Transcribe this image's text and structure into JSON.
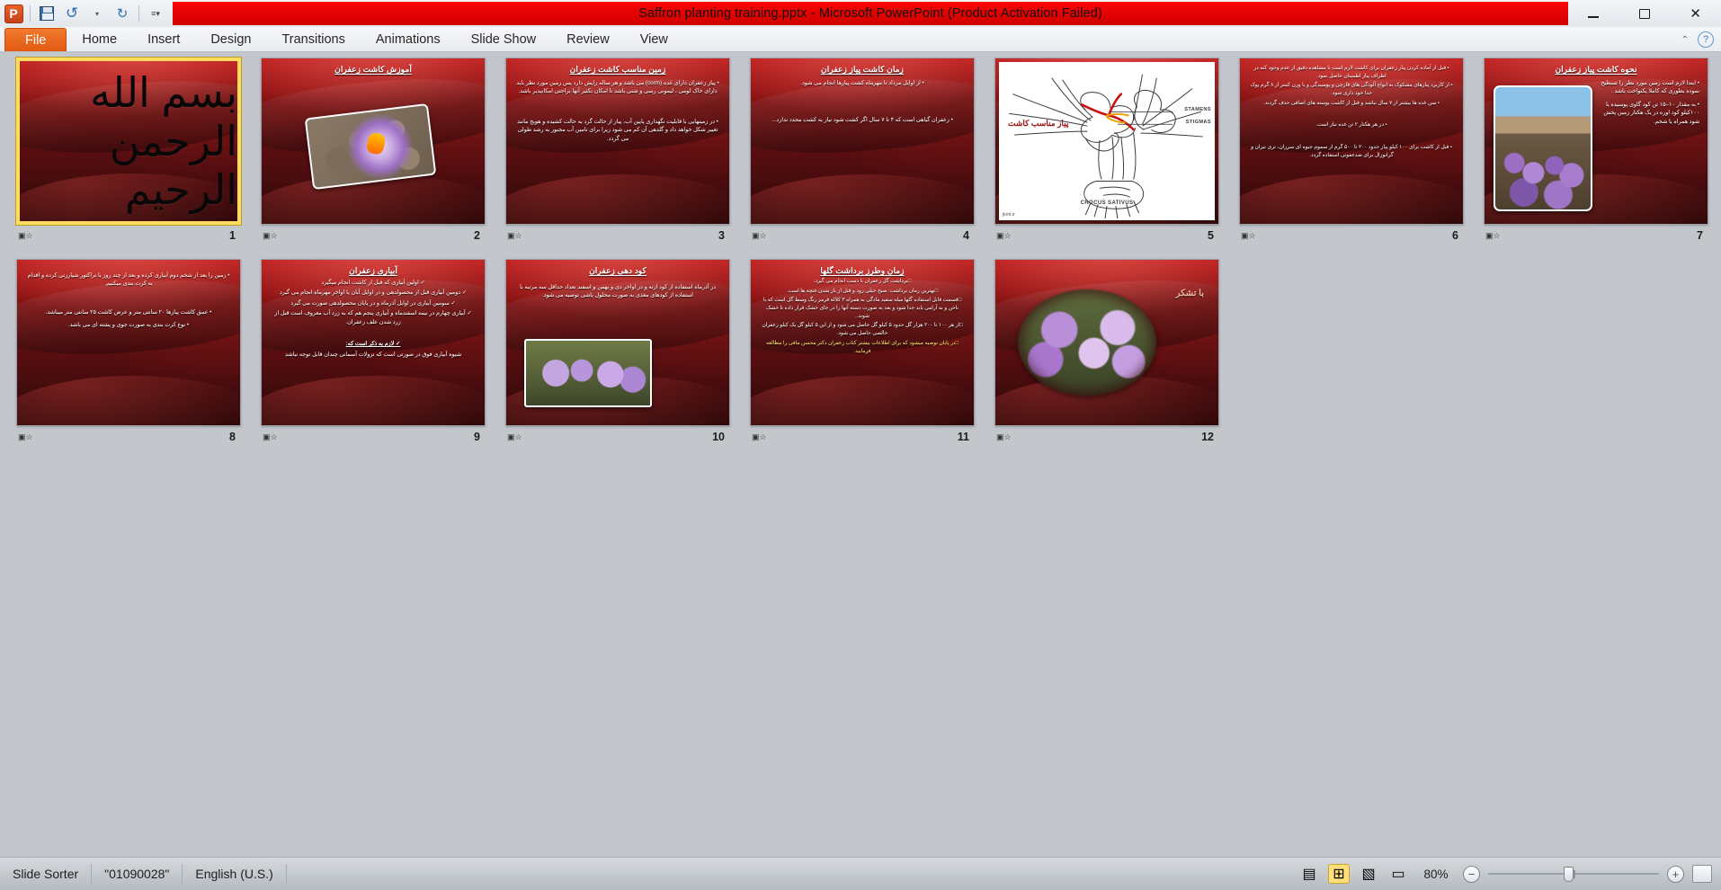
{
  "window": {
    "title": "Saffron planting training.pptx  -  Microsoft PowerPoint (Product Activation Failed)",
    "accent_red": "#e40202",
    "accent_orange": "#e35a10",
    "minimize": "–",
    "restore": "❐",
    "close": "✕"
  },
  "quick_access": {
    "app_icon": "powerpoint-icon",
    "app_letter": "P",
    "save": "save-icon",
    "undo": "↺",
    "undo_dropdown": "▾",
    "redo": "↻",
    "customize": "≡▾"
  },
  "ribbon": {
    "tabs": [
      {
        "label": "File",
        "active": true
      },
      {
        "label": "Home",
        "active": false
      },
      {
        "label": "Insert",
        "active": false
      },
      {
        "label": "Design",
        "active": false
      },
      {
        "label": "Transitions",
        "active": false
      },
      {
        "label": "Animations",
        "active": false
      },
      {
        "label": "Slide Show",
        "active": false
      },
      {
        "label": "Review",
        "active": false
      },
      {
        "label": "View",
        "active": false
      }
    ],
    "minimize_ribbon": "⌃",
    "help": "?"
  },
  "slides": [
    {
      "number": "1",
      "selected": true,
      "kind": "calligraphy",
      "title": "",
      "calligraphy": "بسم الله الرحمن الرحيم",
      "body": []
    },
    {
      "number": "2",
      "selected": false,
      "kind": "title-photo",
      "title": "آموزش کاشت زعفران",
      "body": []
    },
    {
      "number": "3",
      "selected": false,
      "kind": "text",
      "title": "زمین مناسب کاشت زعفران",
      "body": [
        "پیاز زعفران دارای غده (corm) می باشد و هر ساله زایش دارد پس زمین مورد نظر باید دارای خاک لومی ، لیمونی رسی و شنی باشد تا امکان تکثیر آنها براحتی امکانپذیر باشد.",
        "در زمینهایی با قابلیت نگهداری پایین آب، پیاز از حالت گرد به حالت کشیده و هویج مانند تغییر شکل خواهد داد و گلدهی آن کم می شود زیرا برای تامین آب مجبور به رشد طولی می گردد."
      ]
    },
    {
      "number": "4",
      "selected": false,
      "kind": "text",
      "title": "زمان کاشت پیاز زعفران",
      "body": [
        "از اوایل مرداد تا مهرماه کشت پیازها انجام می شود.",
        "زعفران گیاهی است که ۴ تا ۷ سال اگر کشت شود نیاز به کشت مجدد ندارد..."
      ]
    },
    {
      "number": "5",
      "selected": false,
      "kind": "diagram",
      "title": "",
      "diagram": {
        "fa_label": "پیاز مناسب کاشت",
        "tag_stamens": "STAMENS",
        "tag_stigmas": "STIGMAS",
        "species": "CROCUS SATIVUS",
        "credit": "jkmt.ir"
      },
      "body": []
    },
    {
      "number": "6",
      "selected": false,
      "kind": "text",
      "title": "",
      "body": [
        "قبل از آماده کردن پیاز زعفران برای کاشت لازم است با مشاهده دقیق از عدم وجود کنه در اطراف پیاز اطمینان حاصل نمود.",
        "از کاربرد پیازهای مشکوک به انواع آلودگی های قارچی و پوسیدگی و یا وزن کمتر از ۸ گرم پوک جدا خود داری شود.",
        "سن غده ها بیشتر از ۷ سال نباشد و قبل از کاشت پوسته های اضافی حذف گردند.",
        "در هر هکتار ۲ تن غده نیاز است.",
        "قبل از کاشت برای ۱۰۰ کیلو پیاز حدود ۲۰۰ تا ۵۰۰ گرم از سموم جیوه ای سرزان، تری تیزان و گرانوزال برای ضدعفونی استفاده گردد."
      ]
    },
    {
      "number": "7",
      "selected": false,
      "kind": "title-photo-text",
      "title": "نحوه کاشت پیاز زعفران",
      "body": [
        "ایتدا لازم است زمین مورد نظر را تسطیح نموده بطوری که کاملا یکنواخت باشد .",
        "به مقدار ۱۰–۱۵ تن کود گاوی پوسیده یا ۱۰۰کیلو کود اوره در یک هکتار زمین پخش شود همراه یا شخم."
      ]
    },
    {
      "number": "8",
      "selected": false,
      "kind": "text",
      "title": "",
      "body": [
        "زمین را بعد از شخم دوم آبیاری کرده و بعد از چند روز با تراکتور شیارزنی کرده و اقدام به کرت بندی میکنیم.",
        "عمق کاشت پیازها ۲۰ سانتی متر و عرض کاشت ۲۵ سانتی متر میباشد.",
        "نوع کرت بندی به صورت جوی و پشته ای می باشد."
      ]
    },
    {
      "number": "9",
      "selected": false,
      "kind": "text-check",
      "title": "آبیاری زعفران",
      "body": [
        "اولین آبیاری که قبل از کاشت انجام میگیرد",
        "دومین آبیاری قبل از محصولدهی و در اوایل آبان یا اواخر مهرماه انجام می گیرد",
        "سومین آبیاری در اوایل آذرماه و در پایان محصولدهی صورت می گیرد",
        "آبیاری چهارم در نیمه اسفندماه و آبیاری پنجم هم که به زرد آب معروف است قبل از زرد شدن علف زعفران."
      ],
      "footer_title": "لازم به ذکر است که:",
      "footer_text": "شیوه آبیاری فوق در صورتی است که نزولات آسمانی چندان قابل توجه نباشد"
    },
    {
      "number": "10",
      "selected": false,
      "kind": "title-text-photo",
      "title": "کود دهی زعفران",
      "body": [
        "در آذرماه استفاده از کود ازته و در اواخر دی و بهمن و اسفند تعداد حداقل سه مرتبه با استفاده از کودهای مغذی به صورت محلول پاشی توصیه می شود."
      ]
    },
    {
      "number": "11",
      "selected": false,
      "kind": "text-box",
      "title": "زمان وطرز برداشت گلها",
      "body": [
        "برداشت گل زعفران با دست انجام می گیرد.",
        "بهترین زمان برداشت: صبح خیلی زود و قبل از باز شدن غنچه ها است.",
        "قسمت قابل استفاده گلها میله سفید مادگی به همراه ۳ کلاله قرمز رنگ وسط گل است که با ناخن و به آرامی باید جدا شود و بعد به صورت دسته آنها را در جای خشک قرار داده تا خشک شوند..",
        "از هر ۱۰۰ تا ۲۰۰ هزار گل حدود ۵ کیلو گل حاصل می شود و از این ۵ کیلو گل یک کیلو زعفران خالصی حاصل می شود."
      ],
      "highlight": "در پایان توصیه میشود که برای اطلاعات بیشتر کتاب زعفران دکتر محسن مافی را مطالعه فرمایید."
    },
    {
      "number": "12",
      "selected": false,
      "kind": "thanks",
      "title": "با تشکر",
      "body": []
    }
  ],
  "status_bar": {
    "view_name": "Slide Sorter",
    "theme": "\"01090028\"",
    "language": "English (U.S.)",
    "zoom_level": "80%",
    "zoom_out": "−",
    "zoom_in": "+",
    "views": [
      {
        "name": "normal-view-button",
        "glyph": "▤",
        "active": false
      },
      {
        "name": "slide-sorter-view-button",
        "glyph": "⊞",
        "active": true
      },
      {
        "name": "reading-view-button",
        "glyph": "▧",
        "active": false
      },
      {
        "name": "slide-show-button",
        "glyph": "▭",
        "active": false
      }
    ],
    "fit_button": "fit-slide-to-window-button"
  }
}
